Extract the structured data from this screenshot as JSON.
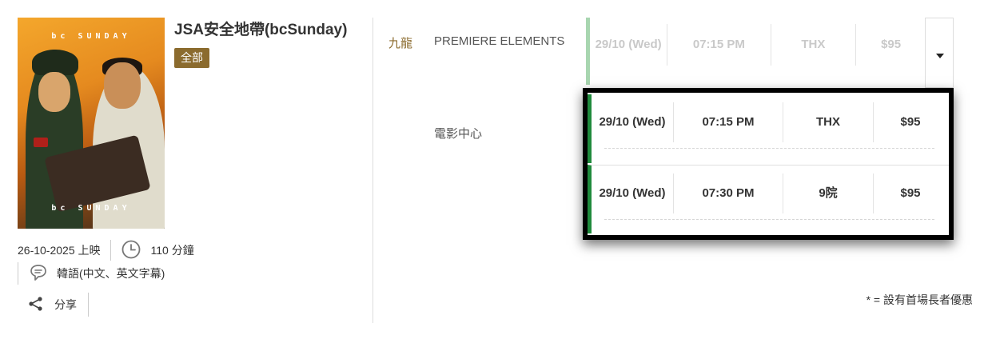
{
  "movie": {
    "title": "JSA安全地帶(bcSunday)",
    "category": "全部",
    "poster_brand_top": "bc SUNDAY",
    "poster_brand_bottom": "bc SUNDAY",
    "release": "26-10-2025 上映",
    "duration": "110 分鐘",
    "language": "韓語(中文、英文字幕)",
    "share_label": "分享"
  },
  "showtimes": {
    "region": "九龍",
    "cinemas": [
      {
        "name": "PREMIERE ELEMENTS",
        "sessions": [
          {
            "date": "29/10 (Wed)",
            "time": "07:15 PM",
            "house": "THX",
            "price": "$95"
          }
        ]
      },
      {
        "name": "電影中心",
        "sessions": [
          {
            "date": "29/10 (Wed)",
            "time": "07:15 PM",
            "house": "THX",
            "price": "$95"
          },
          {
            "date": "29/10 (Wed)",
            "time": "07:30 PM",
            "house": "9院",
            "price": "$95"
          }
        ]
      }
    ]
  },
  "footnote": "* = 設有首場長者優惠",
  "colors": {
    "accent_gold": "#8b6b2e",
    "session_green": "#1f8a3c",
    "session_green_light": "#a8d6b0"
  },
  "icons": {
    "clock": "clock-icon",
    "subtitle": "speech-bubble-icon",
    "share": "share-icon",
    "dropdown": "caret-down-icon"
  }
}
